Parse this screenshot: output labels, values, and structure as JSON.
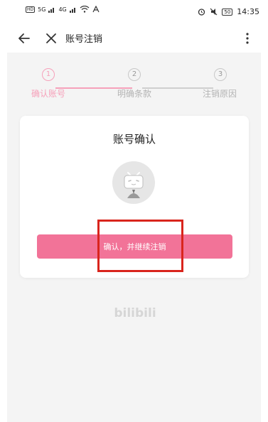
{
  "status_bar": {
    "badge_top": "HD",
    "signal_1": "5G",
    "signal_2": "4G",
    "battery": "50",
    "time": "14:35"
  },
  "nav": {
    "title": "账号注销",
    "back_icon": "arrow-left-icon",
    "close_icon": "close-icon",
    "more_icon": "more-vertical-icon"
  },
  "steps": [
    {
      "number": "1",
      "label": "确认账号",
      "active": true
    },
    {
      "number": "2",
      "label": "明确条款",
      "active": false
    },
    {
      "number": "3",
      "label": "注销原因",
      "active": false
    }
  ],
  "card": {
    "title": "账号确认",
    "button_label": "确认，并继续注销"
  },
  "logo_text": "bilibili",
  "colors": {
    "accent": "#f27398",
    "step_active": "#f6a1ba",
    "highlight": "#d9251d",
    "background": "#f4f4f4"
  }
}
